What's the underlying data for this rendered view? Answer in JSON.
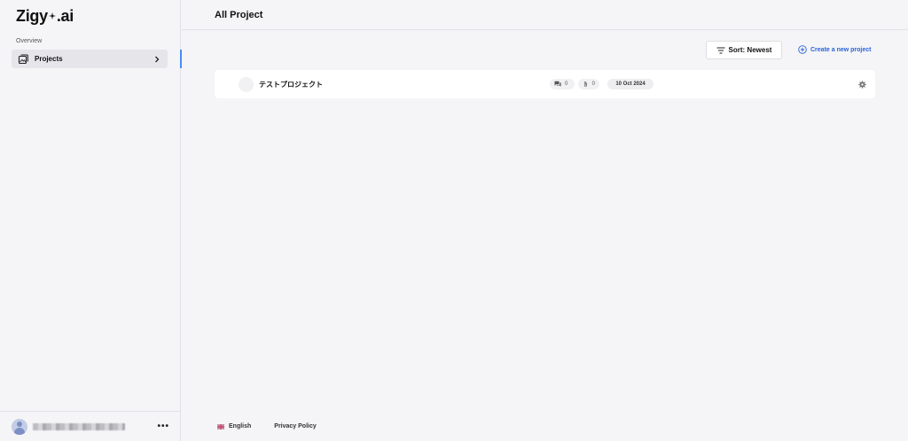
{
  "app": {
    "logo_left": "Zigy",
    "logo_right": ".ai"
  },
  "sidebar": {
    "section_label": "Overview",
    "items": [
      {
        "label": "Projects",
        "icon": "projects-icon",
        "active": true
      }
    ],
    "user": {
      "more_label": "•••"
    }
  },
  "header": {
    "title": "All Project"
  },
  "toolbar": {
    "sort_label": "Sort: Newest",
    "create_label": "Create a new project"
  },
  "projects": [
    {
      "name": "テストプロジェクト",
      "messages": "0",
      "files": "0",
      "date": "10 Oct 2024"
    }
  ],
  "footer": {
    "language": "English",
    "privacy": "Privacy Policy"
  },
  "colors": {
    "accent": "#2a62d9",
    "active_indicator": "#4a8cf7",
    "background": "#f5f5f7"
  }
}
